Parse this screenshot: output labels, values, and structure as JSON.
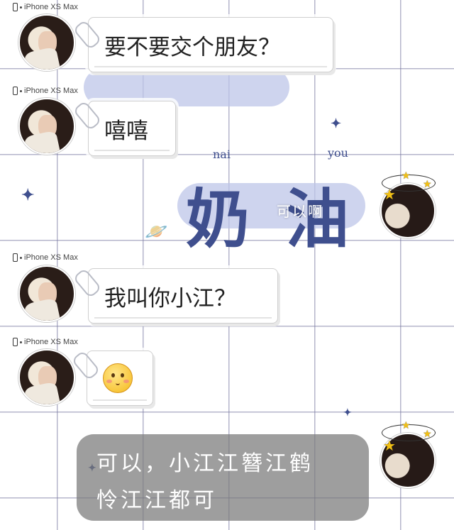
{
  "device_label": "iPhone XS Max",
  "messages": [
    {
      "side": "left",
      "text": "要不要交个朋友？"
    },
    {
      "side": "left",
      "text": "嘻嘻"
    },
    {
      "side": "right",
      "text": "可以啊"
    },
    {
      "side": "left",
      "text": "我叫你小江？"
    },
    {
      "side": "left",
      "emoji": "emoji-face-icon"
    },
    {
      "side": "right",
      "text_line1": "可以，小江江簪江鹤",
      "text_line2": "怜江江都可"
    }
  ],
  "background": {
    "deco_text_1": "奶",
    "deco_text_2": "油",
    "deco_pinyin_1": "nai",
    "deco_pinyin_2": "you"
  },
  "colors": {
    "grid": "#7878a0",
    "deco": "#3f4f8e",
    "bubble_gray": "#787878"
  }
}
